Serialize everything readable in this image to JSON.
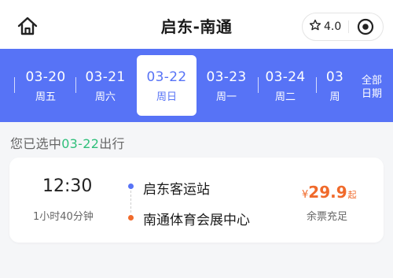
{
  "header": {
    "title": "启东-南通",
    "rating": "4.0",
    "home_icon": "home-icon",
    "star_icon": "star-outline-icon",
    "target_icon": "target-circle-icon"
  },
  "dates": [
    {
      "date": "03-20",
      "weekday": "周五",
      "active": false
    },
    {
      "date": "03-21",
      "weekday": "周六",
      "active": false
    },
    {
      "date": "03-22",
      "weekday": "周日",
      "active": true
    },
    {
      "date": "03-23",
      "weekday": "周一",
      "active": false
    },
    {
      "date": "03-24",
      "weekday": "周二",
      "active": false
    },
    {
      "date": "03",
      "weekday": "周",
      "active": false
    }
  ],
  "all_dates": {
    "line1": "全部",
    "line2": "日期"
  },
  "selection": {
    "prefix": "您已选中",
    "date": "03-22",
    "suffix": "出行"
  },
  "trip": {
    "time": "12:30",
    "duration": "1小时40分钟",
    "from": "启东客运站",
    "to": "南通体育会展中心",
    "price_symbol": "¥",
    "price": "29.9",
    "price_suffix": "起",
    "availability": "余票充足"
  },
  "colors": {
    "accent": "#5773f6",
    "price": "#f06a2b",
    "highlight": "#2fbf7a",
    "background": "#f5f6f8"
  }
}
